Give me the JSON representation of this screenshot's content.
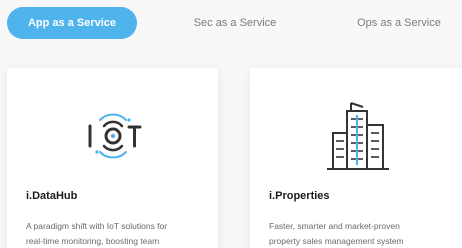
{
  "tabs": [
    {
      "label": "App as a Service",
      "active": true
    },
    {
      "label": "Sec as a Service",
      "active": false
    },
    {
      "label": "Ops as a Service",
      "active": false
    }
  ],
  "cards": [
    {
      "title": "i.DataHub",
      "icon": "iot-icon",
      "description_line1": "A paradigm shift with IoT solutions for",
      "description_line2": "real-time monitoring, boosting team"
    },
    {
      "title": "i.Properties",
      "icon": "building-icon",
      "description_line1": "Faster, smarter and market-proven",
      "description_line2": "property sales management system"
    }
  ],
  "colors": {
    "accent": "#4fb3ec",
    "icon_stroke": "#333333",
    "icon_accent": "#4fb3ec"
  }
}
